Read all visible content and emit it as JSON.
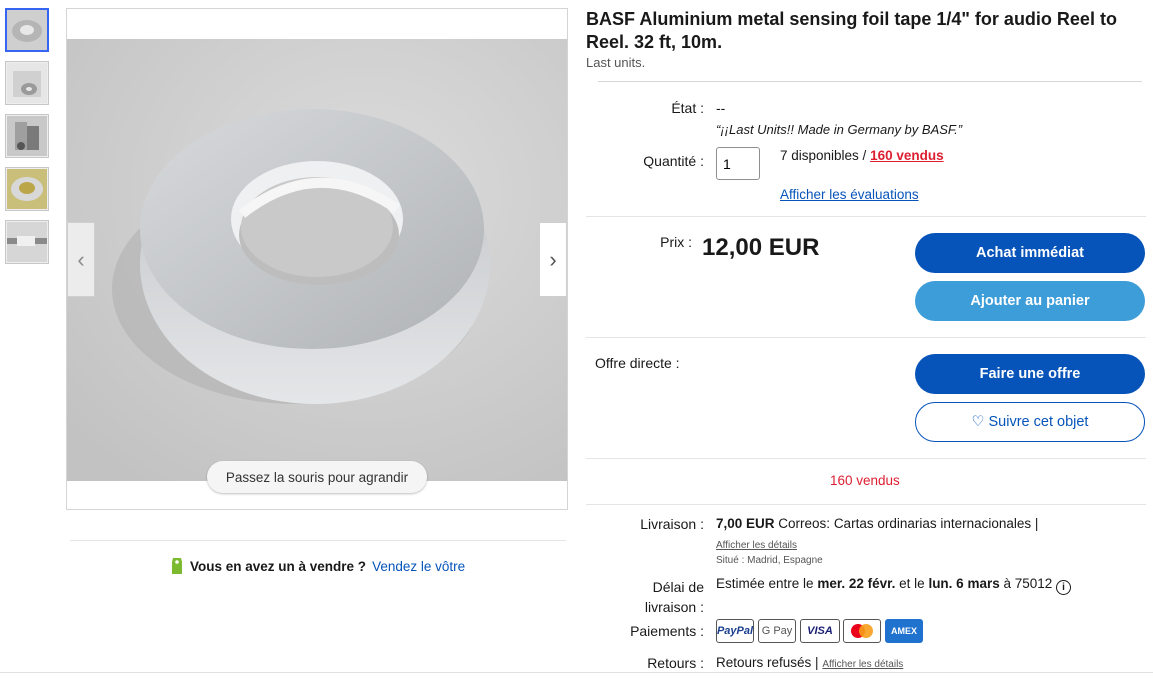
{
  "gallery": {
    "thumbnails": [
      "tape-roll-top",
      "tape-roll-side",
      "tape-packets",
      "tape-roll-yellow",
      "tape-on-reel"
    ],
    "zoom_hint": "Passez la souris pour agrandir"
  },
  "sell": {
    "question": "Vous en avez un à vendre ?",
    "link": "Vendez le vôtre"
  },
  "listing": {
    "title": "BASF Aluminium metal sensing foil tape 1/4\" for audio Reel to Reel. 32 ft, 10m.",
    "subtitle": "Last units.",
    "condition_label": "État :",
    "condition_value": "--",
    "seller_note": "“¡¡Last Units!! Made in Germany by BASF.”",
    "quantity_label": "Quantité :",
    "quantity_value": "1",
    "available": "7 disponibles /",
    "sold_link": "160 vendus",
    "reviews_link": "Afficher les évaluations",
    "price_label": "Prix :",
    "price": "12,00 EUR",
    "buy_now": "Achat immédiat",
    "add_to_cart": "Ajouter au panier",
    "offer_label": "Offre directe :",
    "make_offer": "Faire une offre",
    "watch": "Suivre cet objet",
    "sold_count": "160 vendus"
  },
  "shipping": {
    "label": "Livraison :",
    "cost": "7,00 EUR",
    "service": "Correos: Cartas ordinarias internacionales |",
    "details_link": "Afficher les détails",
    "location": "Situé : Madrid, Espagne",
    "delivery_label_1": "Délai de",
    "delivery_label_2": "livraison :",
    "delivery_prefix": "Estimée entre le",
    "delivery_from": "mer. 22 févr.",
    "delivery_mid": "et le",
    "delivery_to": "lun. 6 mars",
    "delivery_suffix": "à 75012",
    "payments_label": "Paiements :",
    "payment_methods": [
      "PayPal",
      "G Pay",
      "VISA",
      "mastercard",
      "AMEX"
    ],
    "returns_label": "Retours :",
    "returns_value": "Retours refusés |",
    "returns_link": "Afficher les détails"
  },
  "colors": {
    "primary_blue": "#0654ba",
    "light_blue": "#3d9dd9",
    "sold_red": "#dd1e31"
  }
}
